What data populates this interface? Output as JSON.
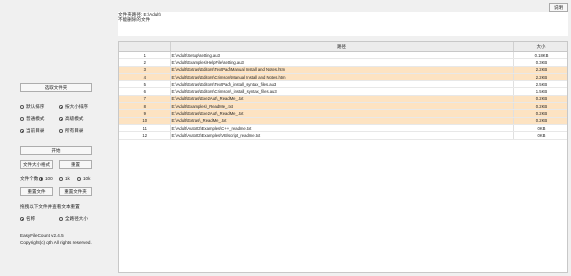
{
  "help_label": "说明",
  "info": {
    "line1": "文件夹路径: E:\\Adult\\",
    "line2": "不能删除的文件"
  },
  "table": {
    "headers": [
      "",
      "路径",
      "大小"
    ],
    "rows": [
      {
        "idx": "1",
        "path": "E:\\Adult\\Setup\\setting.au3",
        "size": "0.18KB",
        "hl": false
      },
      {
        "idx": "2",
        "path": "E:\\Adult\\Examples\\HelpFile\\setting.au3",
        "size": "0.3KB",
        "hl": false
      },
      {
        "idx": "3",
        "path": "E:\\Adult\\Extras\\Editors\\TextPad\\Manual Install and Notes.htm",
        "size": "2.2KB",
        "hl": true
      },
      {
        "idx": "4",
        "path": "E:\\Adult\\Extras\\Editors\\Crimson\\Manual Install and Notes.htm",
        "size": "2.2KB",
        "hl": true
      },
      {
        "idx": "5",
        "path": "E:\\Adult\\Extras\\Editors\\TextPad\\_install_syntax_files.au3",
        "size": "2.5KB",
        "hl": false
      },
      {
        "idx": "6",
        "path": "E:\\Adult\\Extras\\Editors\\Crimson\\_install_syntax_files.au3",
        "size": "1.5KB",
        "hl": false
      },
      {
        "idx": "7",
        "path": "E:\\Adult\\Extras\\Exe2Aut\\_ReadMe_.txt",
        "size": "0.2KB",
        "hl": true
      },
      {
        "idx": "8",
        "path": "E:\\Adult\\Examples\\_ReadMe_.txt",
        "size": "0.2KB",
        "hl": true
      },
      {
        "idx": "9",
        "path": "E:\\Adult\\Extras\\Exe2Aut\\_ReadMe_.txt",
        "size": "0.2KB",
        "hl": true
      },
      {
        "idx": "10",
        "path": "E:\\Adult\\Extras\\_ReadMe_.txt",
        "size": "0.2KB",
        "hl": true
      },
      {
        "idx": "11",
        "path": "E:\\Adult\\AutoIt3\\Examples\\C++_readme.txt",
        "size": "0KB",
        "hl": false
      },
      {
        "idx": "12",
        "path": "E:\\Adult\\AutoIt3\\Examples\\VB\\script_readme.txt",
        "size": "0KB",
        "hl": false
      }
    ]
  },
  "left": {
    "choose_folder": "选取文件夹",
    "sort_radios": [
      {
        "label": "默认排序",
        "on": false
      },
      {
        "label": "按大小排序",
        "on": true
      }
    ],
    "mode_radios": [
      {
        "label": "普通模式",
        "on": false
      },
      {
        "label": "高级模式",
        "on": true
      }
    ],
    "target_radios": [
      {
        "label": "当前目录",
        "on": true
      },
      {
        "label": "所有目录",
        "on": false
      }
    ],
    "start_label": "开始",
    "file_size_label": "文件大小格式",
    "reset_label": "重置",
    "file_count_label": "文件个数",
    "count_radios": [
      {
        "label": "100",
        "on": true
      },
      {
        "label": "1k",
        "on": false
      },
      {
        "label": "10k",
        "on": false
      }
    ],
    "reset_file_label": "重置文件",
    "reset_folder_label": "重置文件夹",
    "drag_label": "拖拽以下文件并查看文本重置",
    "name_radios": [
      {
        "label": "名称",
        "on": true
      },
      {
        "label": "全路径大小",
        "on": false
      }
    ],
    "app_name": "EasyFileCount v2.4.5",
    "copyright": "Copyright(c) qth All rights reserved."
  }
}
